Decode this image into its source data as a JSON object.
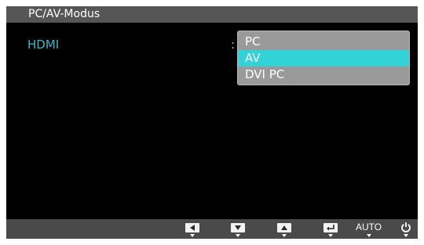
{
  "osd": {
    "title": "PC/AV-Modus",
    "setting_label": "HDMI",
    "separator": ":",
    "options": [
      {
        "label": "PC",
        "selected": false
      },
      {
        "label": "AV",
        "selected": true
      },
      {
        "label": "DVI PC",
        "selected": false
      }
    ]
  },
  "bottom_bar": {
    "buttons": [
      {
        "name": "left-button",
        "icon": "left-arrow-icon"
      },
      {
        "name": "down-button",
        "icon": "down-arrow-icon"
      },
      {
        "name": "up-button",
        "icon": "up-arrow-icon"
      },
      {
        "name": "enter-button",
        "icon": "enter-icon"
      },
      {
        "name": "auto-button",
        "label": "AUTO"
      },
      {
        "name": "power-button",
        "icon": "power-icon"
      }
    ]
  },
  "colors": {
    "accent": "#33d1d8",
    "label": "#36b8c6"
  }
}
